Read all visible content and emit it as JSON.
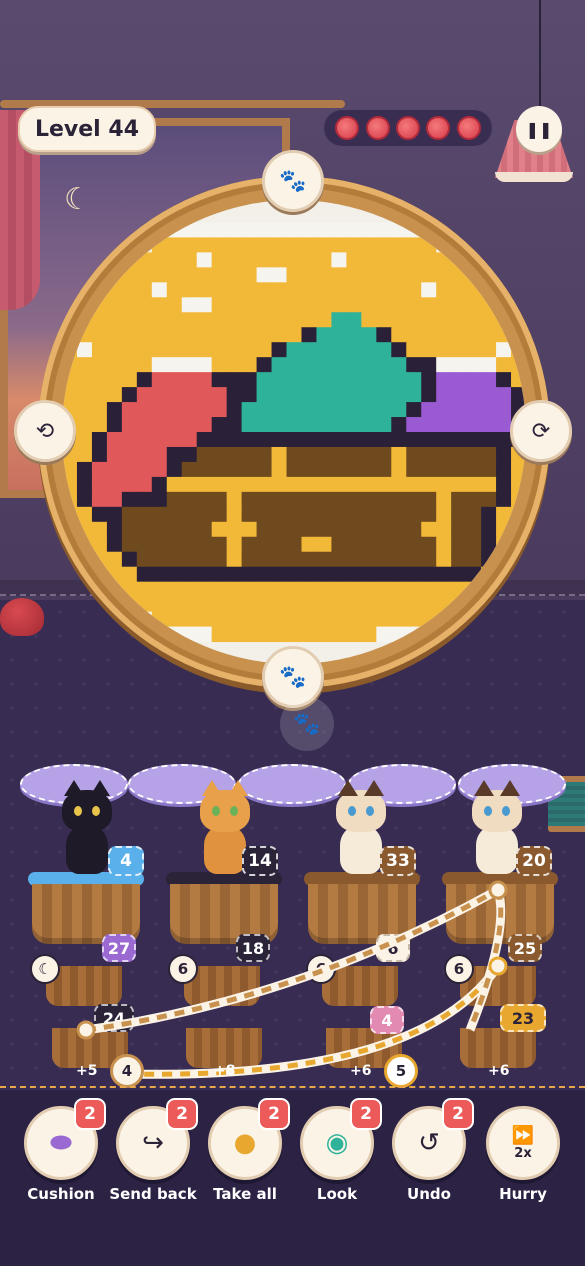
{
  "header": {
    "level_label": "Level 44",
    "lives_count": 5,
    "pause_icon": "pause-icon"
  },
  "hoop": {
    "knob_top_icon": "paw-icon",
    "knob_left_icon": "rotate-left-icon",
    "knob_right_icon": "rotate-right-icon",
    "knob_bottom_icon": "paw-icon",
    "colors": {
      "yellow": "#f2b838",
      "teal": "#2fb29a",
      "purple": "#9a5ad2",
      "red": "#e0585a",
      "brown": "#6e4a1e",
      "dark": "#2a2138",
      "white": "#f6f4ee"
    }
  },
  "cats": [
    {
      "name": "black cat",
      "count": "4",
      "tag_color": "#5ab0ea"
    },
    {
      "name": "orange cat",
      "count": "14",
      "tag_color": "#2b2338"
    },
    {
      "name": "siamese cat",
      "count": "33",
      "tag_color": "#8a5a2e"
    },
    {
      "name": "siamese cat",
      "count": "20",
      "tag_color": "#8a5a2e"
    }
  ],
  "row2": [
    {
      "moon": "",
      "count": "27",
      "tag_color": "#9a6ad2"
    },
    {
      "moon": "6",
      "count": "18",
      "tag_color": "#2b2338"
    },
    {
      "moon": "6",
      "count": "6",
      "tag_color": "#fbf3e6"
    },
    {
      "moon": "6",
      "count": "25",
      "tag_color": "#8a5a2e"
    }
  ],
  "row3": [
    {
      "count": "24",
      "tag_color": "#2b2338"
    },
    {
      "count": "4",
      "tag_color": "#e28ab2"
    },
    {
      "count": "23",
      "tag_color": "#e8a830"
    }
  ],
  "plus_values": [
    "+5",
    "+8",
    "+6",
    "+6"
  ],
  "chain_nodes": [
    "4",
    "5"
  ],
  "tools": [
    {
      "label": "Cushion",
      "badge": "2",
      "icon": "cushion-icon"
    },
    {
      "label": "Send back",
      "badge": "2",
      "icon": "send-back-icon"
    },
    {
      "label": "Take all",
      "badge": "2",
      "icon": "yarn-ball-icon"
    },
    {
      "label": "Look",
      "badge": "2",
      "icon": "eye-icon"
    },
    {
      "label": "Undo",
      "badge": "2",
      "icon": "undo-icon"
    },
    {
      "label": "Hurry",
      "badge": "",
      "icon": "fast-forward-icon",
      "sub": "2x"
    }
  ]
}
